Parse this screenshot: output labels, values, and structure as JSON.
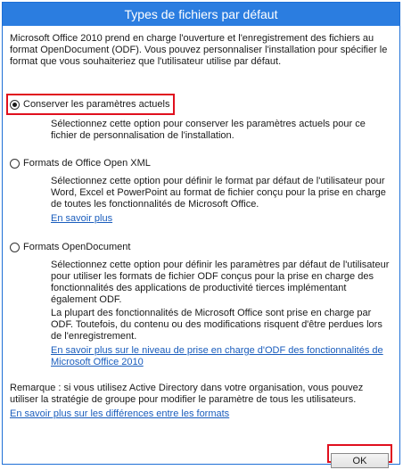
{
  "window": {
    "title": "Types de fichiers par défaut"
  },
  "intro": "Microsoft Office 2010 prend en charge l'ouverture et l'enregistrement des fichiers au format OpenDocument (ODF). Vous pouvez personnaliser l'installation pour spécifier le format que vous souhaiteriez que l'utilisateur utilise par défaut.",
  "options": [
    {
      "label": "Conserver les paramètres actuels",
      "selected": true,
      "description": "Sélectionnez cette option pour conserver les paramètres actuels pour ce fichier de personnalisation de l'installation."
    },
    {
      "label": "Formats de Office Open XML",
      "selected": false,
      "description": "Sélectionnez cette option pour définir le format par défaut de l'utilisateur pour Word, Excel et PowerPoint au format de fichier conçu pour la prise en charge de toutes les fonctionnalités de Microsoft Office.",
      "link": "En savoir plus"
    },
    {
      "label": "Formats OpenDocument",
      "selected": false,
      "description": "Sélectionnez cette option pour définir les paramètres par défaut de l'utilisateur pour utiliser les formats de fichier ODF conçus pour la prise en charge des fonctionnalités des applications de productivité tierces implémentant également ODF.",
      "description2": "La plupart des fonctionnalités de Microsoft Office sont prise en charge par ODF. Toutefois, du contenu ou des modifications risquent d'être perdues lors de l'enregistrement.",
      "link": "En savoir plus sur le niveau de prise en charge d'ODF des fonctionnalités de Microsoft Office 2010"
    }
  ],
  "remark": "Remarque : si vous utilisez Active Directory dans votre organisation, vous pouvez utiliser la stratégie de groupe pour modifier le paramètre de tous les utilisateurs.",
  "remark_link": "En savoir plus sur les différences entre les formats",
  "buttons": {
    "ok": "OK"
  },
  "colors": {
    "title_bar": "#2b7de0",
    "highlight": "#e0101e",
    "link": "#1a5dbd"
  }
}
